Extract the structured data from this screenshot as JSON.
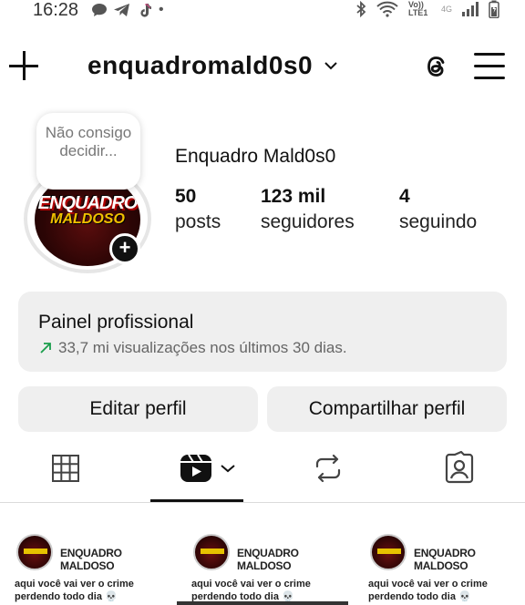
{
  "status_bar": {
    "time": "16:28",
    "left_icons": [
      "chat-bubble-icon",
      "telegram-icon",
      "tiktok-icon",
      "dot-icon"
    ],
    "network_label": "Vo)) LTE1",
    "signal_label": "4G",
    "right_icons": [
      "bluetooth-icon",
      "wifi-icon",
      "signal-icon",
      "battery-icon"
    ]
  },
  "header": {
    "username": "enquadromald0s0"
  },
  "profile": {
    "note": "Não consigo decidir...",
    "avatar_text_line1": "ENQUADRO",
    "avatar_text_line2": "MALDOSO",
    "display_name": "Enquadro Mald0s0",
    "stats": [
      {
        "value": "50",
        "label": "posts"
      },
      {
        "value": "123 mil",
        "label": "seguidores"
      },
      {
        "value": "4",
        "label": "seguindo"
      }
    ]
  },
  "professional_panel": {
    "title": "Painel profissional",
    "subtitle": "33,7 mi visualizações nos últimos 30 dias.",
    "accent_color": "#1a9e4b"
  },
  "actions": {
    "edit_label": "Editar perfil",
    "share_label": "Compartilhar perfil"
  },
  "tabs": {
    "items": [
      "grid-icon",
      "reels-icon",
      "repost-icon",
      "tagged-icon"
    ],
    "active": "reels-icon"
  },
  "reels": [
    {
      "name": "ENQUADRO MALDOSO",
      "caption": "aqui você vai ver o crime perdendo todo dia 💀"
    },
    {
      "name": "ENQUADRO MALDOSO",
      "caption": "aqui você vai ver o crime perdendo todo dia 💀"
    },
    {
      "name": "ENQUADRO MALDOSO",
      "caption": "aqui você vai ver o crime perdendo todo dia 💀"
    }
  ]
}
